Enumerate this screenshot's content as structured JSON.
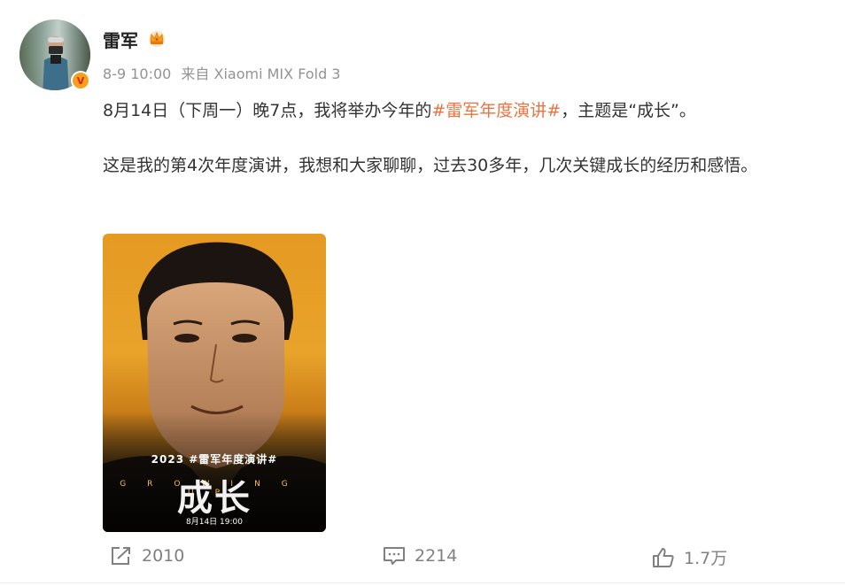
{
  "post": {
    "author_name": "雷军",
    "time": "8-9 10:00",
    "source": "来自 Xiaomi MIX Fold 3",
    "paragraph1_before": "8月14日（下周一）晚7点，我将举办今年的",
    "hashtag": "#雷军年度演讲#",
    "paragraph1_after": "，主题是“成长”。",
    "paragraph2": "这是我的第4次年度演讲，我想和大家聊聊，过去30多年，几次关键成长的经历和感悟。"
  },
  "poster": {
    "year_line": "2023 #雷军年度演讲#",
    "title": "成长",
    "english": "GROWING UP",
    "date": "8月14日 19:00"
  },
  "actions": {
    "share_count": "2010",
    "comment_count": "2214",
    "like_count": "1.7万"
  },
  "colors": {
    "hashtag": "#eb7340",
    "meta": "#939393",
    "verified_badge": "#f7a01e"
  },
  "icons": {
    "verified": "verified-v-icon",
    "crown": "crown-icon",
    "share": "share-icon",
    "comment": "comment-icon",
    "like": "thumbs-up-icon"
  }
}
